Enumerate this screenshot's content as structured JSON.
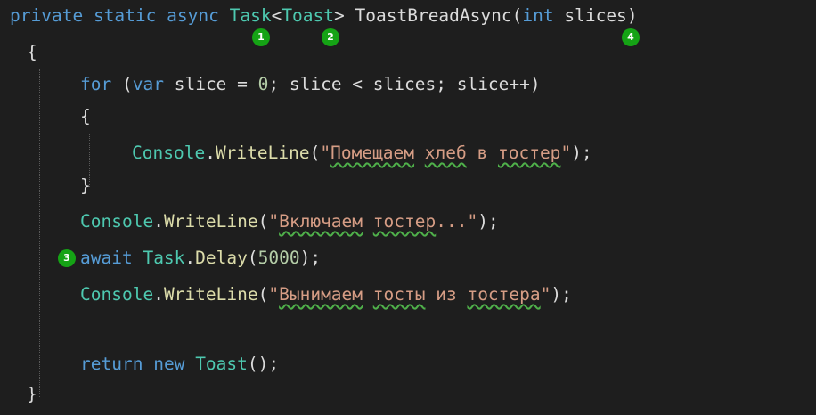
{
  "code": {
    "l1": {
      "kw_private": "private",
      "kw_static": "static",
      "kw_async": "async",
      "type_task": "Task",
      "lt": "<",
      "type_toast": "Toast",
      "gt": ">",
      "method": "ToastBreadAsync",
      "lparen": "(",
      "kw_int": "int",
      "param": "slices",
      "rparen": ")"
    },
    "l2": {
      "brace": "{"
    },
    "l3": {
      "kw_for": "for",
      "lparen": "(",
      "kw_var": "var",
      "expr1": "slice = ",
      "zero": "0",
      "expr2": "; slice < slices; slice++)"
    },
    "l4": {
      "brace": "{"
    },
    "l5": {
      "console": "Console",
      "dot": ".",
      "method": "WriteLine",
      "lparen": "(",
      "q1": "\"",
      "w1": "Помещаем",
      "sp1": " ",
      "w2": "хлеб",
      "sp2": " в ",
      "w3": "тостер",
      "q2": "\"",
      "end": ");"
    },
    "l6": {
      "brace": "}"
    },
    "l7": {
      "console": "Console",
      "dot": ".",
      "method": "WriteLine",
      "lparen": "(",
      "q1": "\"",
      "w1": "Включаем",
      "sp1": " ",
      "w2": "тостер",
      "rest": "...\"",
      "end": ");"
    },
    "l8": {
      "kw_await": "await",
      "sp": " ",
      "type_task": "Task",
      "dot": ".",
      "method": "Delay",
      "lparen": "(",
      "num": "5000",
      "end": ");"
    },
    "l9": {
      "console": "Console",
      "dot": ".",
      "method": "WriteLine",
      "lparen": "(",
      "q1": "\"",
      "w1": "Вынимаем",
      "sp1": " ",
      "w2": "тосты",
      "sp2": " из ",
      "w3": "тостера",
      "q2": "\"",
      "end": ");"
    },
    "l11": {
      "kw_return": "return",
      "kw_new": "new",
      "type_toast": "Toast",
      "end": "();"
    },
    "l12": {
      "brace": "}"
    }
  },
  "badges": {
    "b1": "1",
    "b2": "2",
    "b3": "3",
    "b4": "4"
  },
  "colors": {
    "background": "#1e1e1e",
    "keyword": "#569cd6",
    "type": "#4ec9b0",
    "method": "#dcdcaa",
    "string": "#d69d85",
    "number": "#b5cea8",
    "text": "#dcdcdc",
    "badge": "#15a315",
    "squiggle": "#4fb04a"
  }
}
